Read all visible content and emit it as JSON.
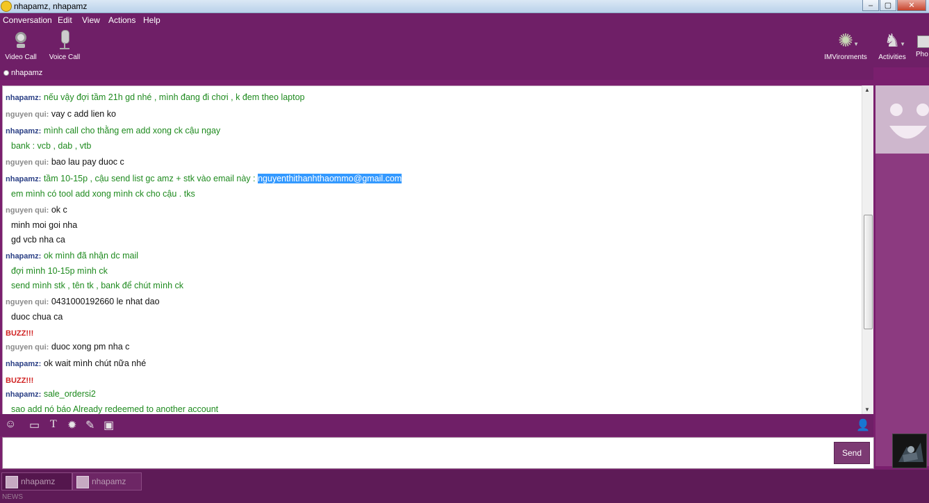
{
  "window": {
    "title": "nhapamz, nhapamz"
  },
  "menu": [
    "Conversation",
    "Edit",
    "View",
    "Actions",
    "Help"
  ],
  "toolbar": {
    "left": [
      {
        "label": "Video Call",
        "icon": "webcam-icon"
      },
      {
        "label": "Voice Call",
        "icon": "microphone-icon"
      }
    ],
    "right": [
      {
        "label": "IMVironments",
        "icon": "imvironments-icon"
      },
      {
        "label": "Activities",
        "icon": "chess-icon"
      },
      {
        "label": "Pho",
        "icon": "photos-icon"
      }
    ]
  },
  "contact": {
    "name": "nhapamz"
  },
  "chat": {
    "messages": [
      {
        "speaker": "nhapamz:",
        "text": "nếu vậy đợi tầm 21h gd nhé , mình đang đi chơi , k đem theo laptop"
      },
      {
        "speaker": "nguyen qui:",
        "text": "vay c add lien ko"
      },
      {
        "speaker": "nhapamz:",
        "text": "mình call cho thằng em add xong ck cậu ngay"
      },
      {
        "text": "bank : vcb , dab , vtb"
      },
      {
        "speaker": "nguyen qui:",
        "text": "bao lau pay duoc c"
      },
      {
        "speaker": "nhapamz:",
        "text": "tầm 10-15p , cậu send list gc amz + stk vào email này : ",
        "highlight": "nguyenthithanhthaommo@gmail.com"
      },
      {
        "text": "em mình có tool add xong mình ck cho cậu . tks"
      },
      {
        "speaker": "nguyen qui:",
        "text": "ok c"
      },
      {
        "text": "minh moi goi nha"
      },
      {
        "text": "gd vcb nha ca"
      },
      {
        "speaker": "nhapamz:",
        "text": "ok mình đã nhận dc mail"
      },
      {
        "text": "đợi mình 10-15p mình ck"
      },
      {
        "text": "send mình stk , tên tk , bank để chút mình ck"
      },
      {
        "speaker": "nguyen qui:",
        "text": "0431000192660 le nhat dao"
      },
      {
        "text": "duoc chua ca"
      },
      {
        "text": "BUZZ!!!"
      },
      {
        "speaker": "nguyen qui:",
        "text": "duoc xong pm nha c"
      },
      {
        "speaker": "nhapamz:",
        "text": "ok wait mình chút nữa nhé"
      },
      {
        "text": "BUZZ!!!"
      },
      {
        "speaker": "nhapamz:",
        "text": "sale_ordersi2"
      },
      {
        "text": "sao add nó báo Already redeemed to another account"
      }
    ]
  },
  "input": {
    "value": ""
  },
  "send_label": "Send",
  "format_icons": [
    "emoticon-icon",
    "winks-icon",
    "font-icon",
    "audibles-icon",
    "attach-icon",
    "share-icon"
  ],
  "taskbar": {
    "tabs": [
      {
        "label": "nhapamz"
      },
      {
        "label": "nhapamz"
      }
    ],
    "news": "NEWS"
  },
  "colors": {
    "frame": "#7a1f6e",
    "me": "#2a3f85",
    "them_name": "#8a8a8a",
    "me_msg": "#1e8a1e",
    "buzz": "#d02020",
    "selection": "#3399ff"
  }
}
